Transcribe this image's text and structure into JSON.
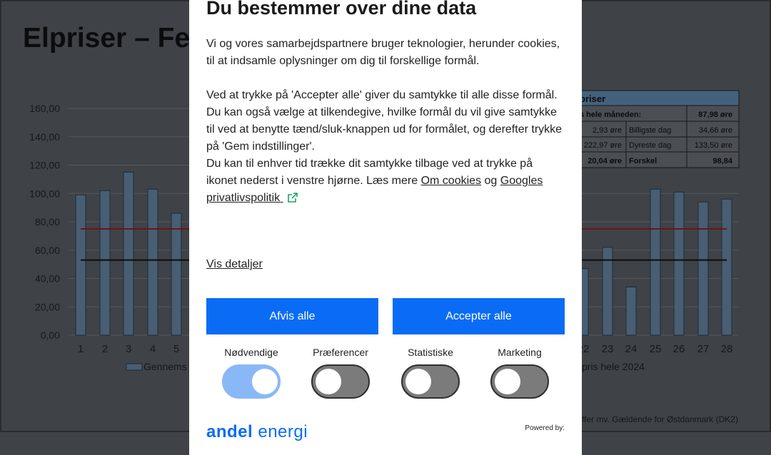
{
  "background": {
    "title": "Elpriser – Fe",
    "yticks": [
      "160,00",
      "140,00",
      "120,00",
      "100,00",
      "80,00",
      "60,00",
      "40,00",
      "20,00",
      "0,00"
    ],
    "xticks_left": [
      "1",
      "2",
      "3",
      "4",
      "5"
    ],
    "xticks_right": [
      "22",
      "23",
      "24",
      "25",
      "26",
      "27",
      "28"
    ],
    "legend_left": "Gennems",
    "legend_right": "pris hele 2024",
    "footer": "ffer mv. Gældende for Østdanmark (DK2)",
    "table": {
      "header": "priser",
      "row1_label": "s hele måneden:",
      "row1_value": "87,98 øre",
      "row2": [
        "2,93 øre",
        "Billigste dag",
        "34,66 øre"
      ],
      "row3": [
        "222,97 øre",
        "Dyreste dag",
        "133,50 øre"
      ],
      "row4": [
        "20,04 øre",
        "Forskel",
        "98,84"
      ]
    }
  },
  "chart_data": {
    "type": "bar",
    "categories": [
      "1",
      "2",
      "3",
      "4",
      "5",
      "22",
      "23",
      "24",
      "25",
      "26",
      "27",
      "28"
    ],
    "values": [
      99,
      102,
      115,
      103,
      86,
      47,
      62,
      34,
      103,
      101,
      94,
      96
    ],
    "ylim": [
      0,
      160
    ],
    "reference_lines": [
      75,
      53
    ]
  },
  "dialog": {
    "title": "Du bestemmer over dine data",
    "para1": "Vi og vores samarbejdspartnere bruger teknologier, herunder cookies, til at indsamle oplysninger om dig til forskellige formål.",
    "para2": "Ved at trykke på 'Accepter alle' giver du samtykke til alle disse formål. Du kan også vælge at tilkendegive, hvilke formål du vil give samtykke til ved at benytte tænd/sluk-knappen ud for formålet, og derefter trykke på 'Gem indstillinger'.",
    "para3_start": "Du kan til enhver tid trække dit samtykke tilbage ved at trykke på ikonet nederst i venstre hjørne. Læs mere ",
    "cookies_link": "Om cookies",
    "and": " og",
    "google_link": "Googles privatlivspolitik",
    "details_link": "Vis detaljer",
    "reject_button": "Afvis alle",
    "accept_button": "Accepter alle",
    "toggles": [
      {
        "label": "Nødvendige",
        "on": true
      },
      {
        "label": "Præferencer",
        "on": false
      },
      {
        "label": "Statistiske",
        "on": false
      },
      {
        "label": "Marketing",
        "on": false
      }
    ],
    "brand_a": "andel",
    "brand_b": "energi",
    "powered_by": "Powered by:"
  }
}
